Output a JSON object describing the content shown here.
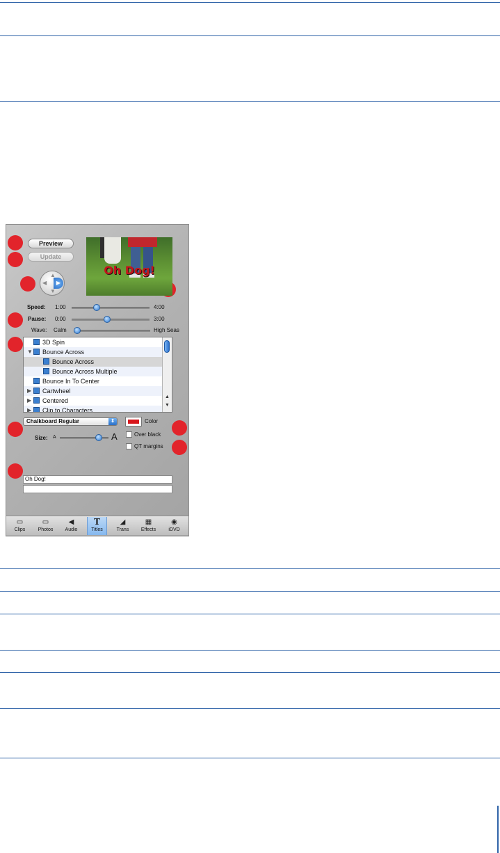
{
  "buttons": {
    "preview": "Preview",
    "update": "Update"
  },
  "preview_text": "Oh Dog!",
  "sliders": {
    "speed": {
      "label": "Speed:",
      "min": "1:00",
      "max": "4:00",
      "value": 0.3
    },
    "pause": {
      "label": "Pause:",
      "min": "0:00",
      "max": "3:00",
      "value": 0.45
    },
    "wave": {
      "label": "Wave:",
      "min": "Calm",
      "max": "High Seas",
      "value": 0.0
    }
  },
  "title_list": [
    {
      "label": "3D Spin",
      "level": 0,
      "expander": ""
    },
    {
      "label": "Bounce Across",
      "level": 0,
      "expander": "▼"
    },
    {
      "label": "Bounce Across",
      "level": 1,
      "expander": "",
      "selected": true
    },
    {
      "label": "Bounce Across Multiple",
      "level": 1,
      "expander": ""
    },
    {
      "label": "Bounce In To Center",
      "level": 0,
      "expander": ""
    },
    {
      "label": "Cartwheel",
      "level": 0,
      "expander": "▶"
    },
    {
      "label": "Centered",
      "level": 0,
      "expander": "▶"
    },
    {
      "label": "Clip to Characters",
      "level": 0,
      "expander": "▶"
    }
  ],
  "font": {
    "selected": "Chalkboard Regular",
    "color_label": "Color",
    "color": "#d8161b"
  },
  "size": {
    "label": "Size:",
    "small": "A",
    "large": "A",
    "value": 0.85
  },
  "checkboxes": {
    "over_black": "Over black",
    "qt_margins": "QT margins"
  },
  "text_lines": [
    "Oh Dog!",
    ""
  ],
  "tabs": [
    {
      "label": "Clips",
      "icon": "clips-icon",
      "glyph": "▭"
    },
    {
      "label": "Photos",
      "icon": "photos-icon",
      "glyph": "▭"
    },
    {
      "label": "Audio",
      "icon": "audio-icon",
      "glyph": "◀"
    },
    {
      "label": "Titles",
      "icon": "titles-icon",
      "glyph": "T",
      "active": true
    },
    {
      "label": "Trans",
      "icon": "trans-icon",
      "glyph": "◢"
    },
    {
      "label": "Effects",
      "icon": "effects-icon",
      "glyph": "▦"
    },
    {
      "label": "iDVD",
      "icon": "idvd-icon",
      "glyph": "◉"
    }
  ],
  "colors": {
    "callout": "#e2242b",
    "rule": "#2f63a8",
    "accent": "#2f79d1"
  }
}
